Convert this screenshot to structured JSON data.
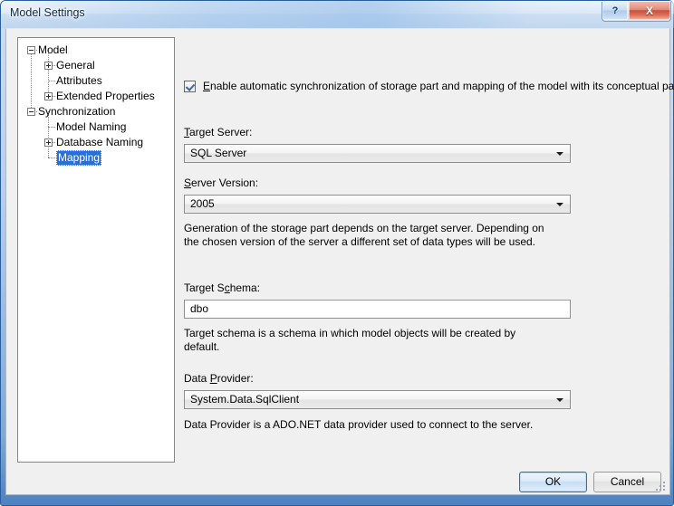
{
  "window": {
    "title": "Model Settings",
    "help_button": "?",
    "close_button": "X"
  },
  "tree": {
    "nodes": [
      {
        "label": "Model",
        "level": 0,
        "expander": "minus",
        "selected": false
      },
      {
        "label": "General",
        "level": 1,
        "expander": "plus",
        "selected": false
      },
      {
        "label": "Attributes",
        "level": 1,
        "expander": "none",
        "selected": false
      },
      {
        "label": "Extended Properties",
        "level": 1,
        "expander": "plus",
        "selected": false
      },
      {
        "label": "Synchronization",
        "level": 0,
        "expander": "minus",
        "selected": false
      },
      {
        "label": "Model Naming",
        "level": 1,
        "expander": "none",
        "selected": false
      },
      {
        "label": "Database Naming",
        "level": 1,
        "expander": "plus",
        "selected": false
      },
      {
        "label": "Mapping",
        "level": 1,
        "expander": "none",
        "selected": true
      }
    ]
  },
  "panel": {
    "enable_sync": {
      "checked": true,
      "accesskey": "E",
      "label_rest": "nable automatic synchronization of storage part and mapping of the model with its conceptual part"
    },
    "target_server": {
      "label_pre": "",
      "accesskey": "T",
      "label_post": "arget Server:",
      "value": "SQL Server"
    },
    "server_version": {
      "accesskey": "S",
      "label_post": "erver Version:",
      "value": "2005"
    },
    "server_help": "Generation of the storage part depends on the target server. Depending on the chosen version of the server a different set of data types will be used.",
    "target_schema": {
      "label_pre": "Target S",
      "accesskey": "c",
      "label_post": "hema:",
      "value": "dbo",
      "placeholder": ""
    },
    "schema_help": "Target schema is a schema in which model objects will be created by default.",
    "data_provider": {
      "label_pre": "Data ",
      "accesskey": "P",
      "label_post": "rovider:",
      "value": "System.Data.SqlClient"
    },
    "provider_help": "Data Provider is a ADO.NET data provider used to connect to the server."
  },
  "footer": {
    "ok_label": "OK",
    "cancel_label": "Cancel"
  },
  "colors": {
    "selection": "#2a6fd6",
    "title_text": "#0b2a4a",
    "close_button": "#c8503a"
  }
}
